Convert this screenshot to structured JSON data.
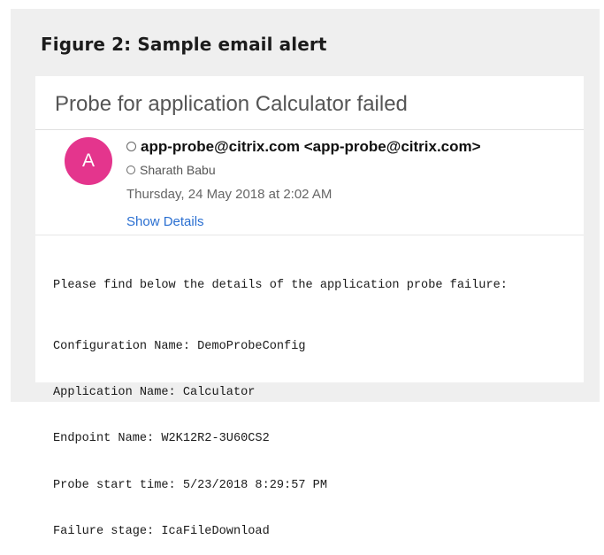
{
  "figure": {
    "title": "Figure 2: Sample email alert"
  },
  "email": {
    "subject": "Probe for application Calculator failed",
    "avatar_initial": "A",
    "from": "app-probe@citrix.com <app-probe@citrix.com>",
    "to": "Sharath Babu",
    "date": "Thursday, 24 May 2018 at 2:02 AM",
    "details_link": "Show Details",
    "avatar_color": "#e4358d",
    "link_color": "#2a6fd1",
    "body": {
      "intro": "Please find below the details of the application probe failure:",
      "lines": [
        "Configuration Name: DemoProbeConfig",
        "Application Name: Calculator",
        "Endpoint Name: W2K12R2-3U60CS2",
        "Probe start time: 5/23/2018 8:29:57 PM",
        "Failure stage: IcaFileDownload"
      ]
    }
  }
}
